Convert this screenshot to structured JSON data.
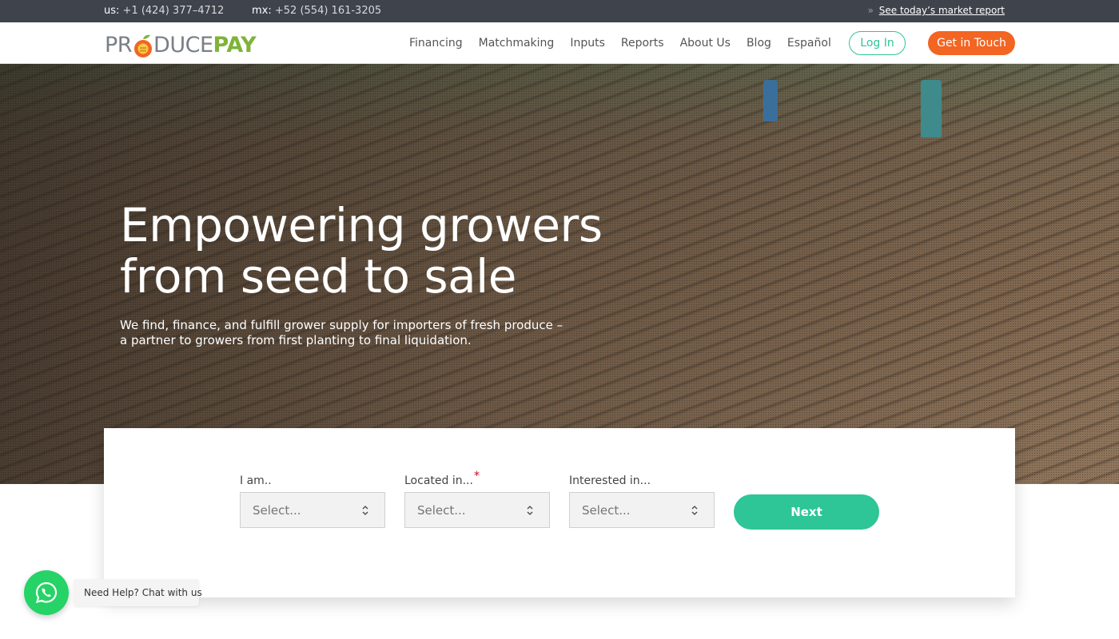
{
  "topbar": {
    "us_label": "us:",
    "us_phone": "+1 (424) 377–4712",
    "mx_label": "mx:",
    "mx_phone": "+52 (554) 161-3205",
    "bullet": "»",
    "market_report_link": "See today’s market report"
  },
  "brand": {
    "logo_text_left": "PR",
    "logo_text_mid": "DUCE",
    "logo_text_right": "PAY",
    "logo_orange": "#f26522",
    "logo_green": "#7fb339",
    "logo_gray": "#7a7f86"
  },
  "nav": {
    "items": [
      "Financing",
      "Matchmaking",
      "Inputs",
      "Reports",
      "About Us",
      "Blog",
      "Español"
    ],
    "login_label": "Log In",
    "cta_label": "Get in Touch"
  },
  "hero": {
    "title_line1": "Empowering growers",
    "title_line2": "from seed to sale",
    "subtitle": "We find, finance, and fulfill grower supply for importers of fresh produce – a partner to growers from first planting to final liquidation."
  },
  "form": {
    "fields": [
      {
        "label": "I am..",
        "required": false,
        "placeholder": "Select..."
      },
      {
        "label": "Located in...",
        "required": true,
        "placeholder": "Select..."
      },
      {
        "label": "Interested in...",
        "required": false,
        "placeholder": "Select..."
      }
    ],
    "required_mark": "*",
    "next_label": "Next"
  },
  "chat": {
    "icon": "whatsapp-icon",
    "label": "Need Help? Chat with us"
  },
  "colors": {
    "accent_green": "#2ec597",
    "accent_orange": "#f26522",
    "topbar_bg": "#3e434c",
    "whatsapp": "#25d366"
  }
}
